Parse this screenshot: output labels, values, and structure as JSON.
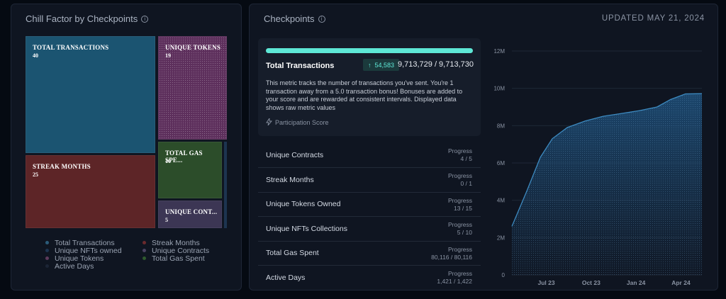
{
  "left_panel": {
    "title": "Chill Factor by Checkpoints",
    "treemap": [
      {
        "label": "TOTAL TRANSACTIONS",
        "value": "40",
        "color": "#1b5471"
      },
      {
        "label": "UNIQUE TOKENS",
        "value": "19",
        "color": "#5d2f5c"
      },
      {
        "label": "STREAK MONTHS",
        "value": "25",
        "color": "#5d2527"
      },
      {
        "label": "TOTAL GAS SPE...",
        "value": "10",
        "color": "#2c4d2a"
      },
      {
        "label": "UNIQUE CONT...",
        "value": "5",
        "color": "#3c3654"
      }
    ],
    "legend": [
      {
        "label": "Total Transactions",
        "color": "#2b5c7a"
      },
      {
        "label": "Streak Months",
        "color": "#6b2a2d"
      },
      {
        "label": "Unique NFTs owned",
        "color": "#1d3450"
      },
      {
        "label": "Unique Contracts",
        "color": "#4a4262"
      },
      {
        "label": "Unique Tokens",
        "color": "#5d3a5c"
      },
      {
        "label": "Total Gas Spent",
        "color": "#2f5a2e"
      },
      {
        "label": "Active Days",
        "color": "#1c2536"
      }
    ]
  },
  "right_panel": {
    "title": "Checkpoints",
    "updated": "UPDATED MAY 21, 2024",
    "featured": {
      "progress_fraction": 0.9999999,
      "title": "Total Transactions",
      "badge": "54,583",
      "value": "9,713,729 / 9,713,730",
      "description": "This metric tracks the number of transactions you've sent. You're 1 transaction away from a 5.0 transaction bonus! Bonuses are added to your score and are rewarded at consistent intervals. Displayed data shows raw metric values",
      "footer": "Participation Score"
    },
    "rows": [
      {
        "label": "Unique Contracts",
        "progress_label": "Progress",
        "progress": "4 / 5"
      },
      {
        "label": "Streak Months",
        "progress_label": "Progress",
        "progress": "0 / 1"
      },
      {
        "label": "Unique Tokens Owned",
        "progress_label": "Progress",
        "progress": "13 / 15"
      },
      {
        "label": "Unique NFTs Collections",
        "progress_label": "Progress",
        "progress": "5 / 10"
      },
      {
        "label": "Total Gas Spent",
        "progress_label": "Progress",
        "progress": "80,116 / 80,116"
      },
      {
        "label": "Active Days",
        "progress_label": "Progress",
        "progress": "1,421 / 1,422"
      }
    ]
  },
  "chart_data": {
    "type": "area",
    "y_ticks": [
      "0",
      "2M",
      "4M",
      "6M",
      "8M",
      "10M",
      "12M"
    ],
    "ylim": [
      0,
      12000000
    ],
    "x_ticks": [
      {
        "label": "Jul 23",
        "t": 1
      },
      {
        "label": "Oct 23",
        "t": 4
      },
      {
        "label": "Jan 24",
        "t": 7
      },
      {
        "label": "Apr 24",
        "t": 10
      }
    ],
    "xlim": [
      -1.3,
      11.4
    ],
    "points": [
      {
        "t": -1.3,
        "y": 2600000
      },
      {
        "t": -0.3,
        "y": 4500000
      },
      {
        "t": 0.6,
        "y": 6300000
      },
      {
        "t": 1.4,
        "y": 7300000
      },
      {
        "t": 2.4,
        "y": 7900000
      },
      {
        "t": 3.6,
        "y": 8250000
      },
      {
        "t": 4.8,
        "y": 8500000
      },
      {
        "t": 6.0,
        "y": 8650000
      },
      {
        "t": 7.2,
        "y": 8800000
      },
      {
        "t": 8.4,
        "y": 9000000
      },
      {
        "t": 9.3,
        "y": 9400000
      },
      {
        "t": 10.3,
        "y": 9700000
      },
      {
        "t": 11.4,
        "y": 9713729
      }
    ],
    "line_color": "#3d8ac0",
    "fill_color": "#1e4f7a",
    "grid": true
  }
}
